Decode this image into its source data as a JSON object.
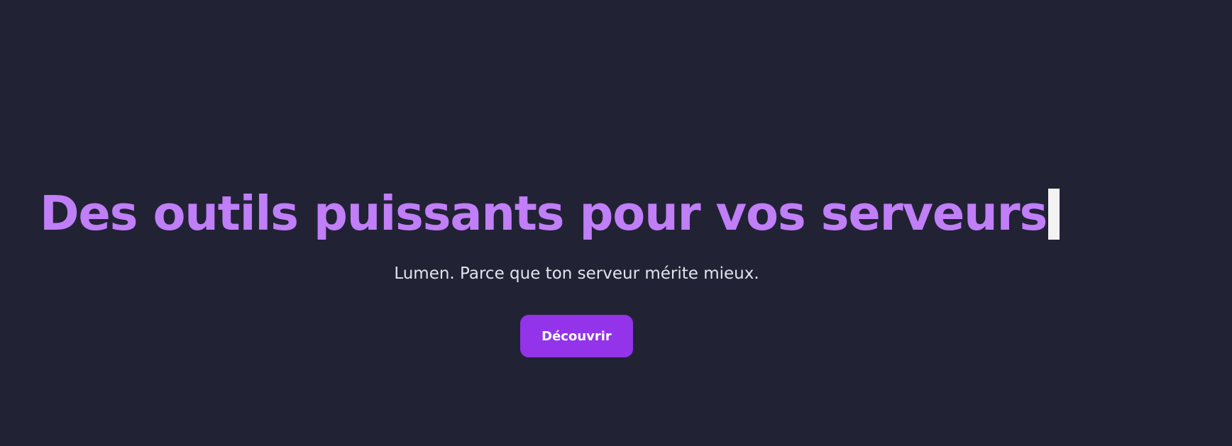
{
  "hero": {
    "headline": "Des outils puissants pour vos serveurs",
    "subtitle": "Lumen. Parce que ton serveur mérite mieux.",
    "cta_label": "Découvrir"
  },
  "colors": {
    "background": "#222235",
    "headline": "#c07ef7",
    "subtitle": "#e3e3ec",
    "cta_background": "#9333ea",
    "cta_text": "#ffffff",
    "cursor": "#f2f2f2"
  }
}
